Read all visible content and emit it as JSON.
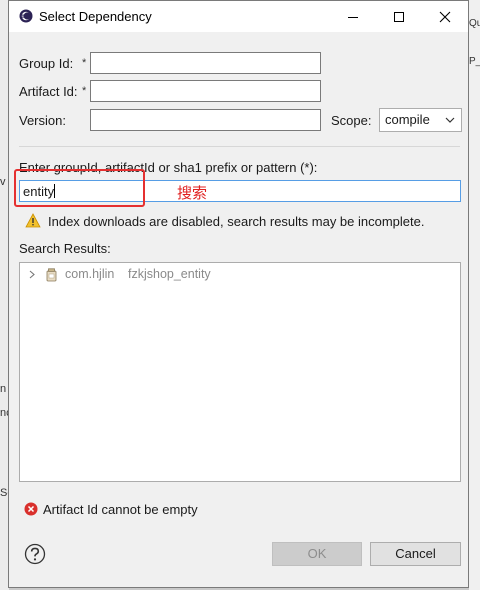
{
  "dialog": {
    "title": "Select Dependency",
    "window_buttons": {
      "minimize": "minimize",
      "maximize": "maximize",
      "close": "close"
    }
  },
  "form": {
    "group_id_label": "Group Id:",
    "artifact_id_label": "Artifact Id:",
    "version_label": "Version:",
    "required_mark": "*",
    "group_id_value": "",
    "artifact_id_value": "",
    "version_value": "",
    "scope_label": "Scope:",
    "scope_value": "compile"
  },
  "search": {
    "prompt": "Enter groupId, artifactId or sha1 prefix or pattern (*):",
    "query": "entity",
    "annotation": "搜索",
    "warning": "Index downloads are disabled, search results may be incomplete."
  },
  "results": {
    "label": "Search Results:",
    "items": [
      {
        "group": "com.hjlin",
        "artifact": "fzkjshop_entity"
      }
    ]
  },
  "status": {
    "error": "Artifact Id cannot be empty"
  },
  "buttons": {
    "ok": "OK",
    "cancel": "Cancel"
  },
  "background": {
    "right_top": "Qu",
    "right_mid": "P_",
    "left_a": "n",
    "left_b": "nc",
    "left_c": "Se",
    "left_v": "v"
  },
  "colors": {
    "accent": "#569de5",
    "annotation": "#e53030",
    "error": "#d9302c",
    "warning": "#f2c12e"
  }
}
